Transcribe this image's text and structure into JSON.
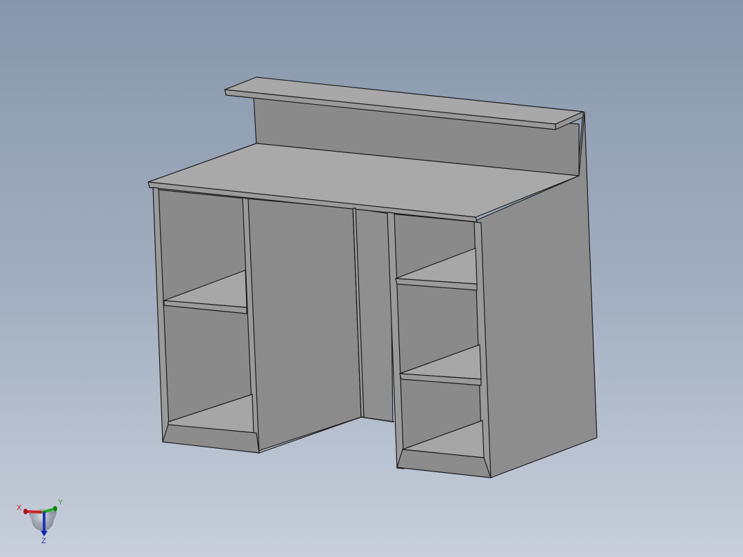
{
  "viewport": {
    "background_top": "#8797ab",
    "background_bottom": "#c8cfdb"
  },
  "model": {
    "name": "reception-desk",
    "colors": {
      "top_face": "#a9a9a9",
      "front_face": "#8a8a8a",
      "edge_face": "#9c9c9c",
      "edge_line": "#1a1a1a"
    }
  },
  "triad": {
    "x_label": "X",
    "y_label": "Y",
    "z_label": "Z",
    "x_color": "#cc2222",
    "y_color": "#22aa22",
    "z_color": "#2233bb"
  }
}
